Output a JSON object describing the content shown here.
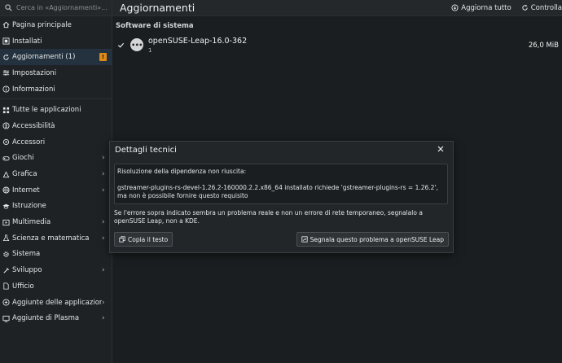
{
  "search": {
    "placeholder": "Cerca in «Aggiornamenti»..."
  },
  "sidebar": {
    "items": [
      {
        "label": "Pagina principale",
        "icon": "home-icon"
      },
      {
        "label": "Installati",
        "icon": "installed-icon"
      },
      {
        "label": "Aggiornamenti (1)",
        "icon": "updates-icon",
        "badge": "!"
      },
      {
        "label": "Impostazioni",
        "icon": "settings-icon"
      },
      {
        "label": "Informazioni",
        "icon": "info-icon"
      }
    ],
    "categories": [
      {
        "label": "Tutte le applicazioni",
        "icon": "all-apps-icon",
        "chevron": false
      },
      {
        "label": "Accessibilità",
        "icon": "accessibility-icon",
        "chevron": false
      },
      {
        "label": "Accessori",
        "icon": "accessories-icon",
        "chevron": false
      },
      {
        "label": "Giochi",
        "icon": "games-icon",
        "chevron": true
      },
      {
        "label": "Grafica",
        "icon": "graphics-icon",
        "chevron": true
      },
      {
        "label": "Internet",
        "icon": "internet-icon",
        "chevron": true
      },
      {
        "label": "Istruzione",
        "icon": "education-icon",
        "chevron": false
      },
      {
        "label": "Multimedia",
        "icon": "multimedia-icon",
        "chevron": true
      },
      {
        "label": "Scienza e matematica",
        "icon": "science-icon",
        "chevron": true
      },
      {
        "label": "Sistema",
        "icon": "system-icon",
        "chevron": false
      },
      {
        "label": "Sviluppo",
        "icon": "development-icon",
        "chevron": true
      },
      {
        "label": "Ufficio",
        "icon": "office-icon",
        "chevron": false
      },
      {
        "label": "Aggiunte delle applicazioni",
        "icon": "app-addons-icon",
        "chevron": true
      },
      {
        "label": "Aggiunte di Plasma",
        "icon": "plasma-addons-icon",
        "chevron": true
      }
    ]
  },
  "header": {
    "title": "Aggiornamenti",
    "update_all": "Aggiorna tutto",
    "check": "Controlla"
  },
  "main": {
    "section": "Software di sistema",
    "package": {
      "name": "openSUSE-Leap-16.0-362",
      "version": "1",
      "size": "26,0 MiB"
    }
  },
  "dialog": {
    "title": "Dettagli tecnici",
    "error_line1": "Risoluzione della dipendenza non riuscita:",
    "error_line2": "gstreamer-plugins-rs-devel-1.26.2-160000.2.2.x86_64 installato richiede 'gstreamer-plugins-rs = 1.26.2', ma non è possibile fornire questo requisito",
    "note": "Se l'errore sopra indicato sembra un problema reale e non un errore di rete temporaneo, segnalalo a openSUSE Leap, non a KDE.",
    "copy_label": "Copia il testo",
    "report_label": "Segnala questo problema a openSUSE Leap"
  },
  "colors": {
    "accent": "#3daee9",
    "badge": "#e08a16",
    "active_bg": "#24323f"
  }
}
